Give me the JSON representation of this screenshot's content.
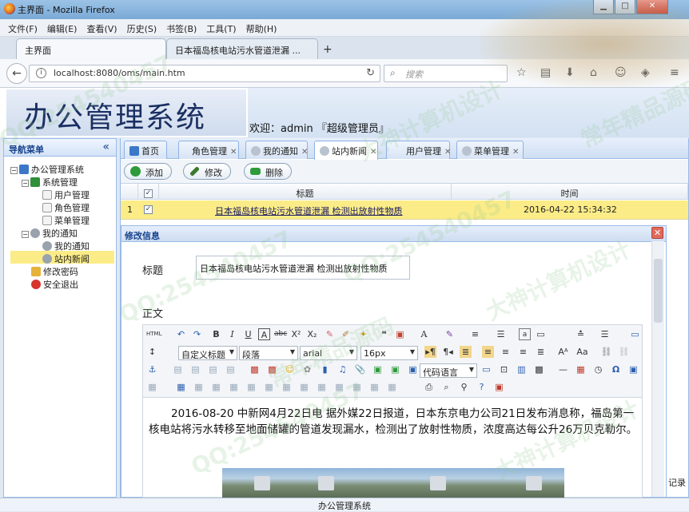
{
  "browser": {
    "window_title": "主界面 - Mozilla Firefox",
    "menu": [
      "文件(F)",
      "编辑(E)",
      "查看(V)",
      "历史(S)",
      "书签(B)",
      "工具(T)",
      "帮助(H)"
    ],
    "tabs": [
      {
        "label": "主界面",
        "active": true
      },
      {
        "label": "日本福岛核电站污水管道泄漏 ...",
        "active": false
      }
    ],
    "url": "localhost:8080/oms/main.htm",
    "search_placeholder": "搜索"
  },
  "app": {
    "title": "办公管理系统",
    "welcome": "欢迎：admin 『超级管理员』",
    "footer": "办公管理系统"
  },
  "sidebar": {
    "title": "导航菜单",
    "collapse_glyph": "«",
    "tree": {
      "root": "办公管理系统",
      "group1": "系统管理",
      "group1_items": [
        "用户管理",
        "角色管理",
        "菜单管理"
      ],
      "group2": "我的通知",
      "group2_items": [
        "我的通知",
        "站内新闻"
      ],
      "extra": [
        "修改密码",
        "安全退出"
      ],
      "selected": "站内新闻"
    }
  },
  "panel_tabs": [
    {
      "label": "首页",
      "closable": false
    },
    {
      "label": "角色管理",
      "closable": true
    },
    {
      "label": "我的通知",
      "closable": true
    },
    {
      "label": "站内新闻",
      "closable": true,
      "active": true
    },
    {
      "label": "用户管理",
      "closable": true
    },
    {
      "label": "菜单管理",
      "closable": true
    }
  ],
  "grid": {
    "buttons": {
      "add": "添加",
      "edit": "修改",
      "delete": "删除"
    },
    "columns": {
      "title": "标题",
      "time": "时间"
    },
    "rows": [
      {
        "index": "1",
        "title": "日本福岛核电站污水管道泄漏 检测出放射性物质",
        "time": "2016-04-22 15:34:32",
        "checked": true
      }
    ]
  },
  "edit_window": {
    "title": "修改信息",
    "field_title_label": "标题",
    "field_title_value": "日本福岛核电站污水管道泄漏 检测出放射性物质",
    "field_body_label": "正文",
    "editor_selects": {
      "heading": "自定义标题",
      "paragraph": "段落",
      "font": "arial",
      "size": "16px",
      "code_lang": "代码语言"
    },
    "body_text": "2016-08-20 中新网4月22日电 据外媒22日报道，日本东京电力公司21日发布消息称，福岛第一核电站将污水转移至地面储罐的管道发现漏水，检测出了放射性物质，浓度高达每公升26万贝克勒尔。",
    "side_label": "记录"
  },
  "watermarks": [
    "QQ:254540457",
    "常年精品源码",
    "大神计算机设计",
    "QQ:254540457",
    "大神计算机设计",
    "QQ:254540457",
    "常年精品源码",
    "大神计算机设计",
    "QQ:254540457"
  ]
}
